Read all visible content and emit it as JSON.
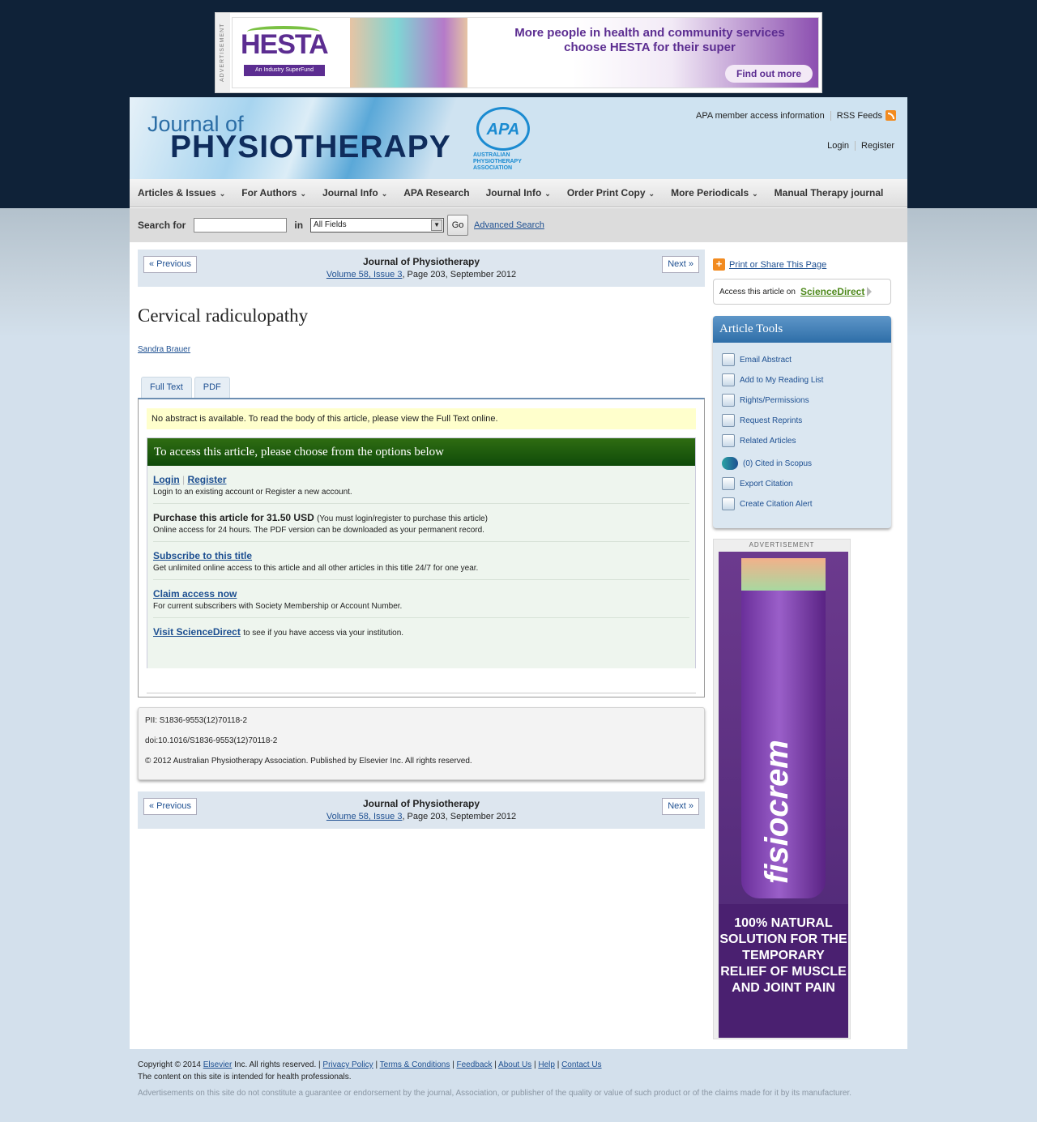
{
  "top_ad": {
    "label": "ADVERTISEMENT",
    "brand": "HESTA",
    "brand_sub": "An Industry SuperFund",
    "headline": "More people in health and community services choose HESTA for their super",
    "cta": "Find out more"
  },
  "header": {
    "logo_small": "Journal of",
    "logo_big": "PHYSIOTHERAPY",
    "apa_mark": "APA",
    "apa_text": "AUSTRALIAN PHYSIOTHERAPY ASSOCIATION",
    "member_access": "APA member access information",
    "rss": "RSS Feeds",
    "login": "Login",
    "register": "Register"
  },
  "nav": {
    "items": [
      {
        "label": "Articles & Issues",
        "dropdown": true
      },
      {
        "label": "For Authors",
        "dropdown": true
      },
      {
        "label": "Journal Info",
        "dropdown": true
      },
      {
        "label": "APA Research",
        "dropdown": false
      },
      {
        "label": "Journal Info",
        "dropdown": true
      },
      {
        "label": "Order Print Copy",
        "dropdown": true
      },
      {
        "label": "More Periodicals",
        "dropdown": true
      },
      {
        "label": "Manual Therapy journal",
        "dropdown": false
      }
    ]
  },
  "search": {
    "label": "Search for",
    "in_label": "in",
    "field_value": "All Fields",
    "go": "Go",
    "advanced": "Advanced Search"
  },
  "article_nav": {
    "prev": "« Previous",
    "next": "Next »",
    "journal": "Journal of Physiotherapy",
    "volume_link": "Volume 58, Issue 3",
    "volume_rest": ", Page 203, September 2012"
  },
  "article": {
    "title": "Cervical radiculopathy",
    "author": "Sandra Brauer"
  },
  "tabs": [
    "Full Text",
    "PDF"
  ],
  "panel": {
    "abstract_note": "No abstract is available. To read the body of this article, please view the Full Text online.",
    "access_heading": "To access this article, please choose from the options below",
    "login": "Login",
    "register": "Register",
    "login_desc": "Login to an existing account or Register a new account.",
    "purchase_title": "Purchase this article for 31.50 USD",
    "purchase_note": "(You must login/register to purchase this article)",
    "purchase_desc": "Online access for 24 hours. The PDF version can be downloaded as your permanent record.",
    "subscribe": "Subscribe to this title",
    "subscribe_desc": "Get unlimited online access to this article and all other articles in this title 24/7 for one year.",
    "claim": "Claim access now",
    "claim_desc": "For current subscribers with Society Membership or Account Number.",
    "visit": "Visit ScienceDirect",
    "visit_desc": "to see if you have access via your institution."
  },
  "meta": {
    "pii": "PII: S1836-9553(12)70118-2",
    "doi": "doi:10.1016/S1836-9553(12)70118-2",
    "copyright": "© 2012 Australian Physiotherapy Association. Published by Elsevier Inc. All rights reserved."
  },
  "sidebar": {
    "print_share": "Print or Share This Page",
    "access_on": "Access this article on",
    "sciencedirect": "ScienceDirect",
    "tools_title": "Article Tools",
    "tools": [
      {
        "label": "Email Abstract",
        "icon": "email-icon"
      },
      {
        "label": "Add to My Reading List",
        "icon": "reading-list-icon"
      },
      {
        "label": "Rights/Permissions",
        "icon": "lock-icon"
      },
      {
        "label": "Request Reprints",
        "icon": "reprint-icon"
      },
      {
        "label": "Related Articles",
        "icon": "related-icon"
      },
      {
        "label": "(0) Cited in Scopus",
        "icon": "scopus-icon"
      },
      {
        "label": "Export Citation",
        "icon": "list-icon"
      },
      {
        "label": "Create Citation Alert",
        "icon": "gear-icon"
      }
    ]
  },
  "side_ad": {
    "label": "ADVERTISEMENT",
    "product": "fisiocrem",
    "claim": "100% NATURAL SOLUTION FOR THE TEMPORARY RELIEF OF MUSCLE AND JOINT PAIN"
  },
  "footer": {
    "copyright_prefix": "Copyright © 2014",
    "elsevier": "Elsevier",
    "copyright_suffix": "Inc. All rights reserved. |",
    "privacy": "Privacy Policy",
    "terms": "Terms & Conditions",
    "feedback": "Feedback",
    "about": "About Us",
    "help": "Help",
    "contact": "Contact Us",
    "line2": "The content on this site is intended for health professionals.",
    "disclaimer": "Advertisements on this site do not constitute a guarantee or endorsement by the journal, Association, or publisher of the quality or value of such product or of the claims made for it by its manufacturer."
  }
}
